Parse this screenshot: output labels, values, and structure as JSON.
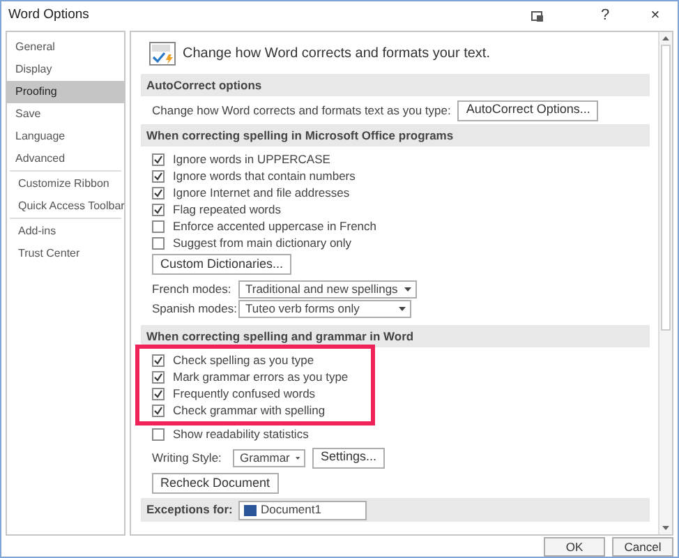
{
  "window": {
    "title": "Word Options",
    "buttons": [
      "?",
      "×"
    ]
  },
  "sidebar": {
    "groups": [
      [
        {
          "label": "General",
          "selected": false
        },
        {
          "label": "Display",
          "selected": false
        },
        {
          "label": "Proofing",
          "selected": true
        },
        {
          "label": "Save",
          "selected": false
        },
        {
          "label": "Language",
          "selected": false
        },
        {
          "label": "Advanced",
          "selected": false
        }
      ],
      [
        {
          "label": "Customize Ribbon",
          "selected": false
        },
        {
          "label": "Quick Access Toolbar",
          "selected": false
        }
      ],
      [
        {
          "label": "Add-ins",
          "selected": false
        },
        {
          "label": "Trust Center",
          "selected": false
        }
      ]
    ]
  },
  "intro": "Change how Word corrects and formats your text.",
  "autocorrect": {
    "header": "AutoCorrect options",
    "label": "Change how Word corrects and formats text as you type:",
    "button": "AutoCorrect Options..."
  },
  "office": {
    "header": "When correcting spelling in Microsoft Office programs",
    "options": [
      {
        "label": "Ignore words in UPPERCASE",
        "checked": true
      },
      {
        "label": "Ignore words that contain numbers",
        "checked": true
      },
      {
        "label": "Ignore Internet and file addresses",
        "checked": true
      },
      {
        "label": "Flag repeated words",
        "checked": true
      },
      {
        "label": "Enforce accented uppercase in French",
        "checked": false
      },
      {
        "label": "Suggest from main dictionary only",
        "checked": false
      }
    ],
    "button": "Custom Dictionaries...",
    "modes": [
      {
        "label": "French modes:",
        "value": "Traditional and new spellings"
      },
      {
        "label": "Spanish modes:",
        "value": "Tuteo verb forms only"
      }
    ]
  },
  "word": {
    "header": "When correcting spelling and grammar in Word",
    "highlighted": [
      {
        "label": "Check spelling as you type",
        "checked": true
      },
      {
        "label": "Mark grammar errors as you type",
        "checked": true
      },
      {
        "label": "Frequently confused words",
        "checked": true
      },
      {
        "label": "Check grammar with spelling",
        "checked": true
      }
    ],
    "options": [
      {
        "label": "Show readability statistics",
        "checked": false
      }
    ],
    "writing_style": {
      "label": "Writing Style:",
      "value": "Grammar",
      "button": "Settings..."
    },
    "recheck": "Recheck Document"
  },
  "exceptions": {
    "label": "Exceptions for:",
    "value": "Document1"
  },
  "footer": {
    "buttons": [
      "OK",
      "Cancel"
    ]
  }
}
